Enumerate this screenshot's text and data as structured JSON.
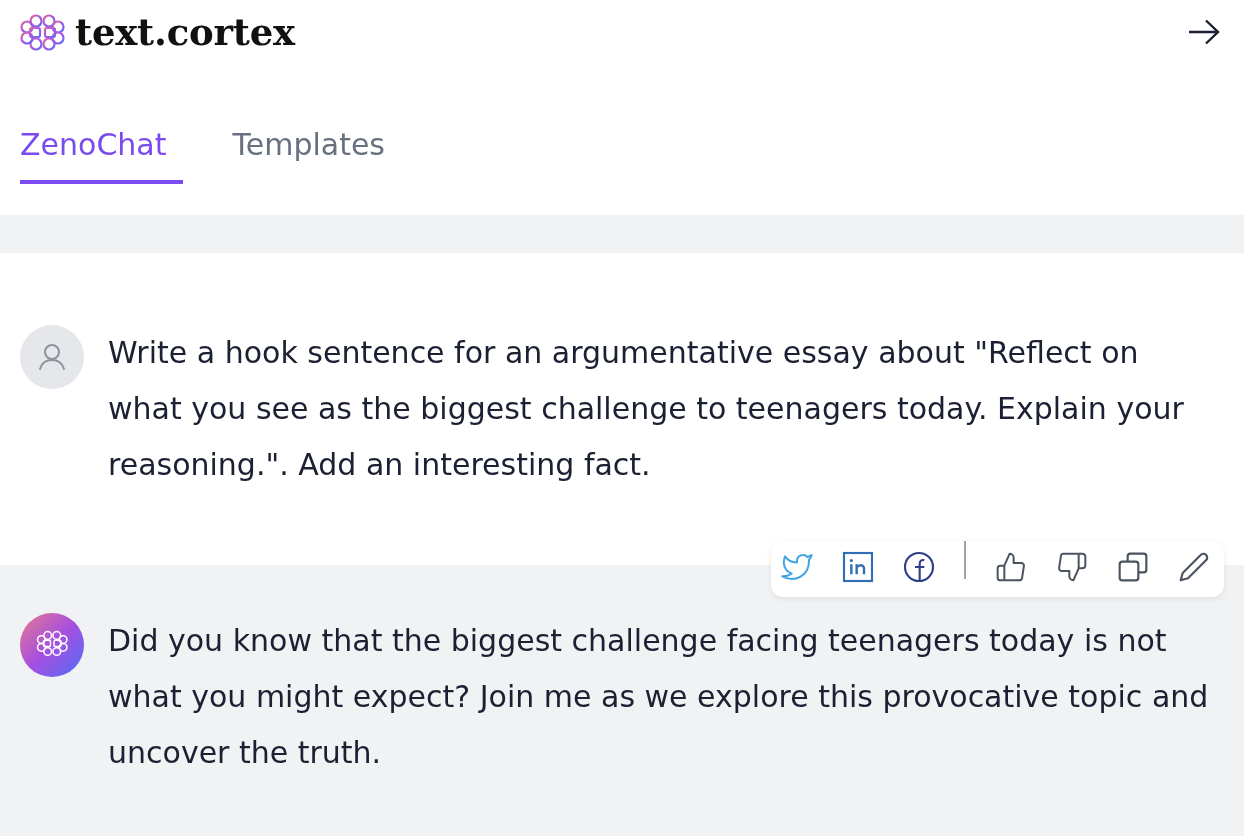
{
  "header": {
    "logo_text": "text.cortex"
  },
  "tabs": [
    {
      "label": "ZenoChat",
      "selected": true
    },
    {
      "label": "Templates",
      "selected": false
    }
  ],
  "messages": [
    {
      "kind": "user",
      "text": "Write a hook sentence for an argumentative essay about \"Reflect on what you see as the biggest challenge to teenagers today. Explain your reasoning.\". Add an interesting fact."
    },
    {
      "kind": "assistant",
      "text": "Did you know that the biggest challenge facing teenagers today is not what you might expect? Join me as we explore this provocative topic and uncover the truth."
    }
  ]
}
